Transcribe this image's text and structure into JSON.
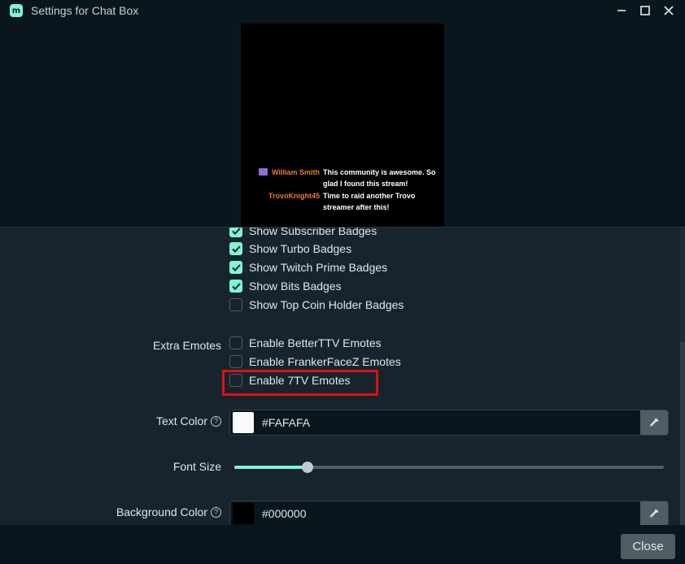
{
  "window": {
    "title": "Settings for Chat Box",
    "logo_glyph": "m"
  },
  "preview": {
    "messages": [
      {
        "user": "William Smith",
        "text": "This community is awesome. So glad I found this stream!",
        "badge": true
      },
      {
        "user": "TrovoKnight45",
        "text": "Time to raid another Trovo streamer after this!",
        "badge": false
      }
    ]
  },
  "badges": {
    "items": [
      {
        "label": "Show Subscriber Badges",
        "checked": true
      },
      {
        "label": "Show Turbo Badges",
        "checked": true
      },
      {
        "label": "Show Twitch Prime Badges",
        "checked": true
      },
      {
        "label": "Show Bits Badges",
        "checked": true
      },
      {
        "label": "Show Top Coin Holder Badges",
        "checked": false
      }
    ]
  },
  "extra_emotes": {
    "label": "Extra Emotes",
    "items": [
      {
        "label": "Enable BetterTTV Emotes",
        "checked": false
      },
      {
        "label": "Enable FrankerFaceZ Emotes",
        "checked": false
      },
      {
        "label": "Enable 7TV Emotes",
        "checked": false
      }
    ]
  },
  "text_color": {
    "label": "Text Color",
    "value": "#FAFAFA",
    "swatch": "#FAFAFA"
  },
  "font_size": {
    "label": "Font Size",
    "fraction": 0.17
  },
  "background_color": {
    "label": "Background Color",
    "value": "#000000",
    "swatch": "#000000"
  },
  "footer": {
    "close_label": "Close"
  },
  "colors": {
    "accent": "#80f5d2",
    "highlight": "#e01010"
  }
}
